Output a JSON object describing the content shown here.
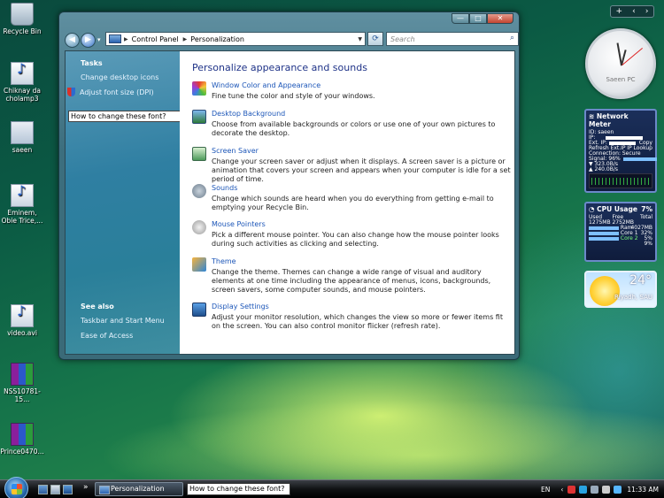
{
  "desktop_icons": [
    {
      "label": "Recycle Bin",
      "icon": "recycle-bin-icon"
    },
    {
      "label": "Chiknay da cholamp3",
      "icon": "media-file-icon"
    },
    {
      "label": "saeen",
      "icon": "shortcut-icon"
    },
    {
      "label": "Eminem, Obie Trice,...",
      "icon": "media-file-icon"
    },
    {
      "label": "video.avi",
      "icon": "media-file-icon"
    },
    {
      "label": "NSS10781-15...",
      "icon": "winrar-icon"
    },
    {
      "label": "Prince0470...",
      "icon": "winrar-icon"
    }
  ],
  "window": {
    "breadcrumb": [
      "Control Panel",
      "Personalization"
    ],
    "search_placeholder": "Search",
    "controls": {
      "minimize": "—",
      "maximize": "□",
      "close": "✕"
    },
    "sidebar": {
      "tasks_heading": "Tasks",
      "tasks": [
        "Change desktop icons",
        "Adjust font size (DPI)"
      ],
      "note": "How to change these font?",
      "see_also_heading": "See also",
      "see_also": [
        "Taskbar and Start Menu",
        "Ease of Access"
      ]
    },
    "main": {
      "heading": "Personalize appearance and sounds",
      "items": [
        {
          "title": "Window Color and Appearance",
          "desc": "Fine tune the color and style of your windows.",
          "icon": "palette-icon"
        },
        {
          "title": "Desktop Background",
          "desc": "Choose from available backgrounds or colors or use one of your own pictures to decorate the desktop.",
          "icon": "desktop-background-icon"
        },
        {
          "title": "Screen Saver",
          "desc": "Change your screen saver or adjust when it displays. A screen saver is a picture or animation that covers your screen and appears when your computer is idle for a set period of time.",
          "icon": "screen-saver-icon"
        },
        {
          "title": "Sounds",
          "desc": "Change which sounds are heard when you do everything from getting e-mail to emptying your Recycle Bin.",
          "icon": "speaker-icon"
        },
        {
          "title": "Mouse Pointers",
          "desc": "Pick a different mouse pointer. You can also change how the mouse pointer looks during such activities as clicking and selecting.",
          "icon": "mouse-icon"
        },
        {
          "title": "Theme",
          "desc": "Change the theme. Themes can change a wide range of visual and auditory elements at one time including the appearance of menus, icons, backgrounds, screen savers, some computer sounds, and mouse pointers.",
          "icon": "theme-icon"
        },
        {
          "title": "Display Settings",
          "desc": "Adjust your monitor resolution, which changes the view so more or fewer items fit on the screen. You can also control monitor flicker (refresh rate).",
          "icon": "monitor-icon"
        }
      ]
    }
  },
  "gadgets": {
    "toolbar": {
      "add": "+",
      "prev": "‹",
      "next": "›"
    },
    "clock_label": "Saeen PC",
    "network_meter": {
      "title": "Network Meter",
      "id": "ID: saeen",
      "ip": "IP:",
      "ext_ip": "Ext. IP:",
      "copy": "Copy",
      "refresh": "Refresh Ext.IP",
      "lookup": "IP Lookup",
      "connection": "Connection: Secure",
      "signal_label": "Signal:",
      "signal": "96%",
      "down": "323.0B/s",
      "up": "240.0B/s"
    },
    "cpu_usage": {
      "title": "CPU Usage",
      "percent": "7%",
      "used_label": "Used",
      "free_label": "Free",
      "total_label": "Total",
      "used": "1275MB",
      "free": "2752MB",
      "total": "4027MB",
      "ram_label": "Ram",
      "ram": "32%",
      "core1_label": "Core 1",
      "core1": "5%",
      "core2_label": "Core 2",
      "core2": "9%"
    },
    "weather": {
      "temp": "24°",
      "city": "Riyadh, SAU"
    }
  },
  "taskbar": {
    "active_window": "Personalization",
    "note": "How to change these font?",
    "language": "EN",
    "time": "11:33 AM",
    "chevron": "»"
  }
}
